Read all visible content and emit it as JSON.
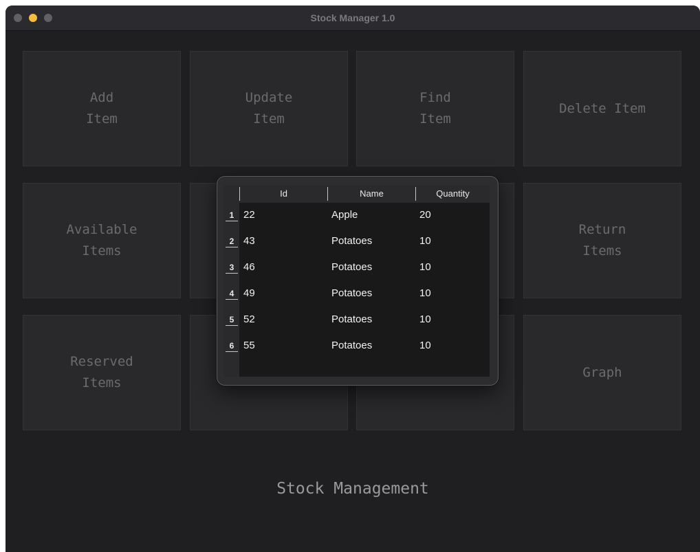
{
  "window": {
    "title": "Stock Manager 1.0"
  },
  "buttons": [
    {
      "label": "Add\nItem"
    },
    {
      "label": "Update\nItem"
    },
    {
      "label": "Find\nItem"
    },
    {
      "label": "Delete Item"
    },
    {
      "label": "Available\nItems"
    },
    {
      "label": ""
    },
    {
      "label": ""
    },
    {
      "label": "Return\nItems"
    },
    {
      "label": "Reserved\nItems"
    },
    {
      "label": ""
    },
    {
      "label": ""
    },
    {
      "label": "Graph"
    }
  ],
  "footer": {
    "label": "Stock Management"
  },
  "table": {
    "columns": [
      "Id",
      "Name",
      "Quantity"
    ],
    "rows": [
      {
        "num": "1",
        "id": "22",
        "name": "Apple",
        "quantity": "20"
      },
      {
        "num": "2",
        "id": "43",
        "name": "Potatoes",
        "quantity": "10"
      },
      {
        "num": "3",
        "id": "46",
        "name": "Potatoes",
        "quantity": "10"
      },
      {
        "num": "4",
        "id": "49",
        "name": "Potatoes",
        "quantity": "10"
      },
      {
        "num": "5",
        "id": "52",
        "name": "Potatoes",
        "quantity": "10"
      },
      {
        "num": "6",
        "id": "55",
        "name": "Potatoes",
        "quantity": "10"
      }
    ]
  },
  "colors": {
    "background": "#1f1f21",
    "button": "#29292b",
    "minimize": "#f4bd3b"
  }
}
